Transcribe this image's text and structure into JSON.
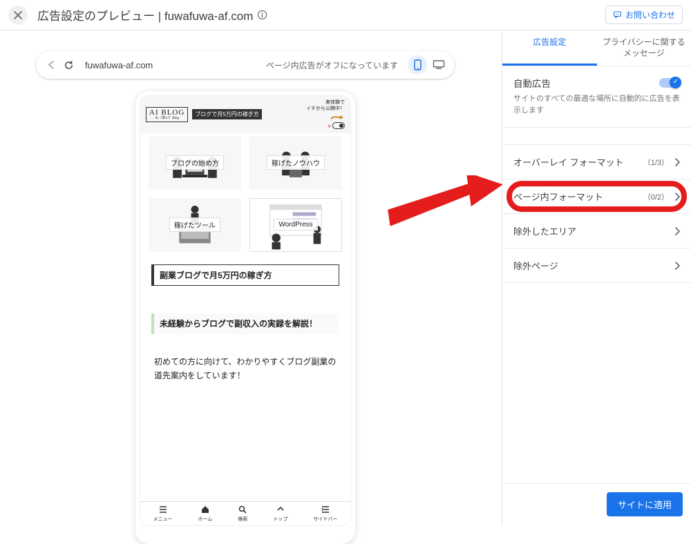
{
  "header": {
    "title": "広告設定のプレビュー | fuwafuwa-af.com",
    "contact": "お問い合わせ"
  },
  "urlbar": {
    "domain": "fuwafuwa-af.com",
    "status": "ページ内広告がオフになっています"
  },
  "blog": {
    "logo_main": "AI BLOG",
    "logo_sub": "Ai（あい）Blog",
    "tagline": "ブログで月5万円の稼ぎ方",
    "sideline1": "実体験で",
    "sideline2": "イチから公開中！",
    "cat1": "ブログの始め方",
    "cat2": "稼げたノウハウ",
    "cat3": "稼げたツール",
    "cat4": "WordPress",
    "h1": "副業ブログで月5万円の稼ぎ方",
    "h2": "未経験からブログで副収入の実録を解説！",
    "body": "初めての方に向けて、わかりやすくブログ副業の道先案内をしています！"
  },
  "nav": {
    "menu": "メニュー",
    "home": "ホーム",
    "search": "検索",
    "top": "トップ",
    "sidebar": "サイドバー"
  },
  "tabs": {
    "t1": "広告設定",
    "t2": "プライバシーに関するメッセージ"
  },
  "auto": {
    "title": "自動広告",
    "desc": "サイトのすべての最適な場所に自動的に広告を表示します"
  },
  "rows": {
    "r1": {
      "name": "オーバーレイ フォーマット",
      "meta": "（1/3）"
    },
    "r2": {
      "name": "ページ内フォーマット",
      "meta": "（0/2）"
    },
    "r3": {
      "name": "除外したエリア"
    },
    "r4": {
      "name": "除外ページ"
    }
  },
  "apply": "サイトに適用"
}
